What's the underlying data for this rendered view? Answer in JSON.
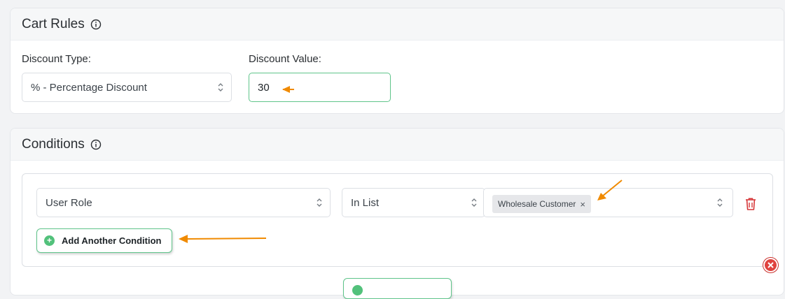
{
  "cart_rules": {
    "title": "Cart Rules",
    "discount_type_label": "Discount Type:",
    "discount_type_value": "% - Percentage Discount",
    "discount_value_label": "Discount Value:",
    "discount_value": "30"
  },
  "conditions": {
    "title": "Conditions",
    "field_value": "User Role",
    "operator_value": "In List",
    "selected_tags": [
      "Wholesale Customer"
    ],
    "tag_remove_symbol": "×",
    "add_condition_label": "Add Another Condition"
  },
  "colors": {
    "accent_green": "#52c17b",
    "annotation_orange": "#f08a00",
    "delete_red": "#d63638"
  },
  "icons": [
    "info-icon",
    "chevron-updown-icon",
    "plus-circle-icon",
    "trash-icon",
    "close-circle-icon"
  ]
}
